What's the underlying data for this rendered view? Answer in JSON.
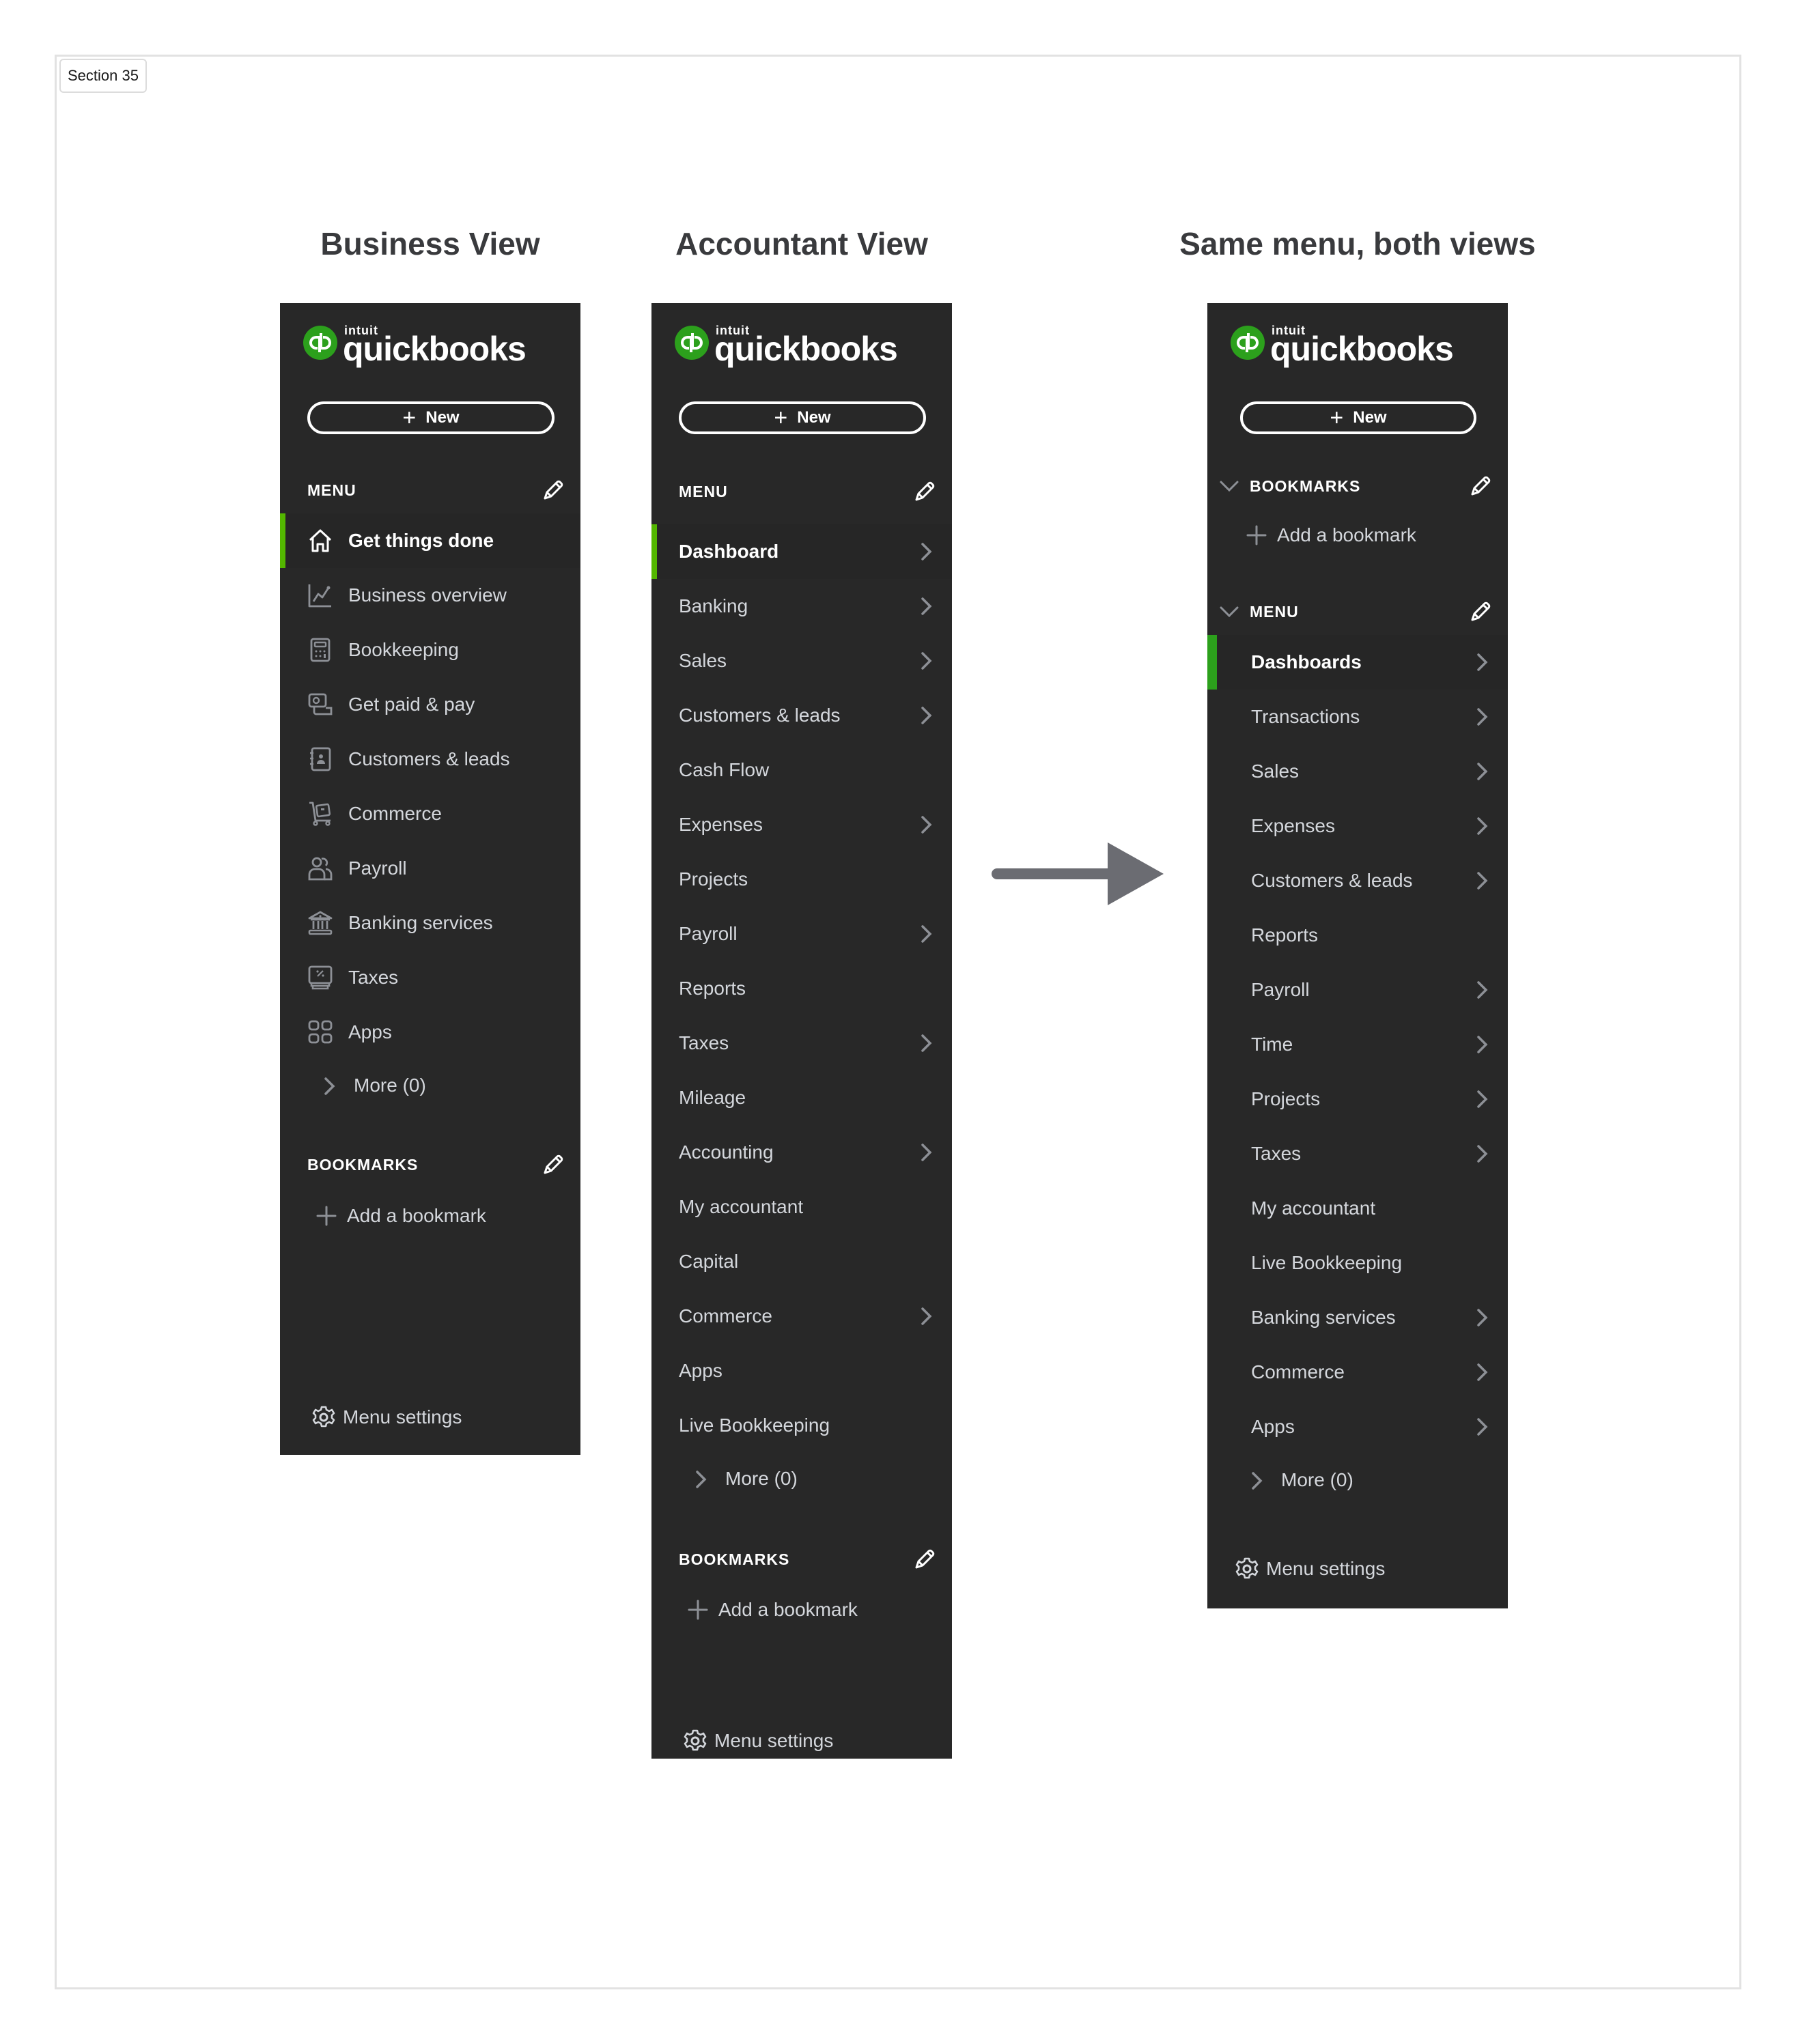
{
  "section_tag": "Section 35",
  "colors": {
    "panel_bg": "#282828",
    "accent_green": "#53b700",
    "brand_green": "#2ca01c",
    "title_text": "#393a3d",
    "arrow": "#6b6c72"
  },
  "brand": {
    "intuit": "intuit",
    "name": "quickbooks",
    "badge": "qb"
  },
  "new_button": {
    "icon": "plus-icon",
    "label": "New"
  },
  "business_view": {
    "title": "Business View",
    "menu_label": "MENU",
    "items": [
      {
        "label": "Get things done",
        "icon": "home-icon",
        "active": true
      },
      {
        "label": "Business overview",
        "icon": "chart-line-icon"
      },
      {
        "label": "Bookkeeping",
        "icon": "calculator-icon"
      },
      {
        "label": "Get paid & pay",
        "icon": "payment-icon"
      },
      {
        "label": "Customers & leads",
        "icon": "contact-book-icon"
      },
      {
        "label": "Commerce",
        "icon": "cart-icon"
      },
      {
        "label": "Payroll",
        "icon": "people-icon"
      },
      {
        "label": "Banking services",
        "icon": "bank-icon"
      },
      {
        "label": "Taxes",
        "icon": "tax-icon"
      },
      {
        "label": "Apps",
        "icon": "apps-grid-icon"
      }
    ],
    "more_label": "More (0)",
    "bookmarks_label": "BOOKMARKS",
    "add_bookmark": "Add a bookmark",
    "menu_settings": "Menu settings"
  },
  "accountant_view": {
    "title": "Accountant View",
    "menu_label": "MENU",
    "items": [
      {
        "label": "Dashboard",
        "has_submenu": true,
        "active": true
      },
      {
        "label": "Banking",
        "has_submenu": true
      },
      {
        "label": "Sales",
        "has_submenu": true
      },
      {
        "label": "Customers & leads",
        "has_submenu": true
      },
      {
        "label": "Cash Flow",
        "has_submenu": false
      },
      {
        "label": "Expenses",
        "has_submenu": true
      },
      {
        "label": "Projects",
        "has_submenu": false
      },
      {
        "label": "Payroll",
        "has_submenu": true
      },
      {
        "label": "Reports",
        "has_submenu": false
      },
      {
        "label": "Taxes",
        "has_submenu": true
      },
      {
        "label": "Mileage",
        "has_submenu": false
      },
      {
        "label": "Accounting",
        "has_submenu": true
      },
      {
        "label": "My accountant",
        "has_submenu": false
      },
      {
        "label": "Capital",
        "has_submenu": false
      },
      {
        "label": "Commerce",
        "has_submenu": true
      },
      {
        "label": "Apps",
        "has_submenu": false
      },
      {
        "label": "Live Bookkeeping",
        "has_submenu": false
      }
    ],
    "more_label": "More (0)",
    "bookmarks_label": "BOOKMARKS",
    "add_bookmark": "Add a bookmark",
    "menu_settings": "Menu settings"
  },
  "unified_view": {
    "title": "Same menu, both views",
    "bookmarks_label": "BOOKMARKS",
    "add_bookmark": "Add a bookmark",
    "menu_label": "MENU",
    "items": [
      {
        "label": "Dashboards",
        "has_submenu": true,
        "active": true
      },
      {
        "label": "Transactions",
        "has_submenu": true
      },
      {
        "label": "Sales",
        "has_submenu": true
      },
      {
        "label": "Expenses",
        "has_submenu": true
      },
      {
        "label": "Customers & leads",
        "has_submenu": true
      },
      {
        "label": "Reports",
        "has_submenu": false
      },
      {
        "label": "Payroll",
        "has_submenu": true
      },
      {
        "label": "Time",
        "has_submenu": true
      },
      {
        "label": "Projects",
        "has_submenu": true
      },
      {
        "label": "Taxes",
        "has_submenu": true
      },
      {
        "label": "My accountant",
        "has_submenu": false
      },
      {
        "label": "Live Bookkeeping",
        "has_submenu": false
      },
      {
        "label": "Banking services",
        "has_submenu": true
      },
      {
        "label": "Commerce",
        "has_submenu": true
      },
      {
        "label": "Apps",
        "has_submenu": true
      }
    ],
    "more_label": "More (0)",
    "menu_settings": "Menu settings"
  },
  "transition_arrow": "arrow-right-icon"
}
